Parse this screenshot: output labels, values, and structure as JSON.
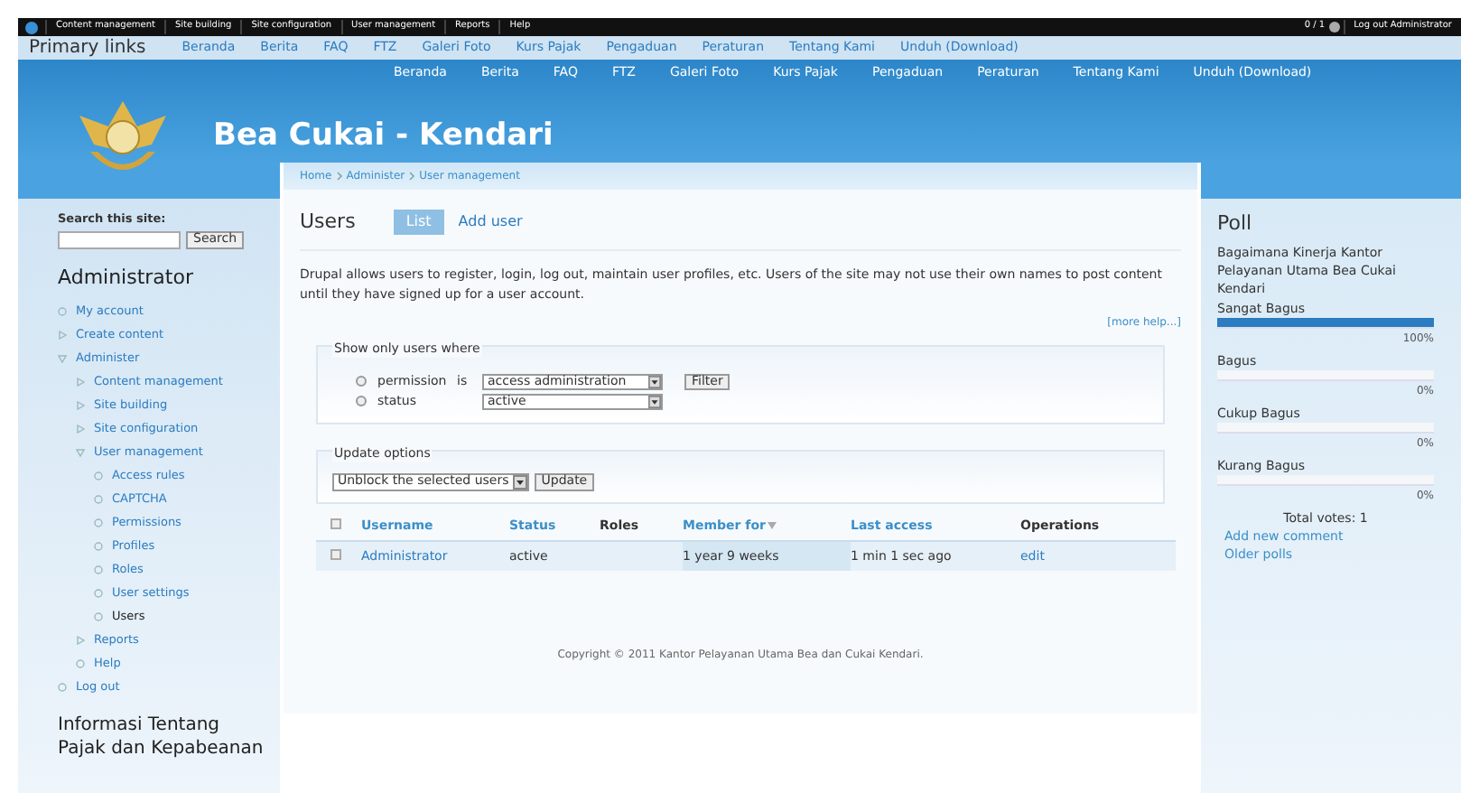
{
  "admin_bar": {
    "items": [
      "Content management",
      "Site building",
      "Site configuration",
      "User management",
      "Reports",
      "Help"
    ],
    "counter": "0 / 1",
    "logout": "Log out Administrator"
  },
  "primary_links": {
    "title": "Primary links",
    "items": [
      "Beranda",
      "Berita",
      "FAQ",
      "FTZ",
      "Galeri Foto",
      "Kurs Pajak",
      "Pengaduan",
      "Peraturan",
      "Tentang Kami",
      "Unduh (Download)"
    ]
  },
  "header": {
    "nav": [
      "Beranda",
      "Berita",
      "FAQ",
      "FTZ",
      "Galeri Foto",
      "Kurs Pajak",
      "Pengaduan",
      "Peraturan",
      "Tentang Kami",
      "Unduh (Download)"
    ],
    "site_name": "Bea Cukai - Kendari"
  },
  "sidebar": {
    "search_label": "Search this site:",
    "search_button": "Search",
    "menu_title": "Administrator",
    "menu": [
      {
        "label": "My account",
        "kind": "leaf",
        "selected": false
      },
      {
        "label": "Create content",
        "kind": "collapsed",
        "selected": false
      },
      {
        "label": "Administer",
        "kind": "expanded",
        "selected": false,
        "children": [
          {
            "label": "Content management",
            "kind": "collapsed",
            "selected": false
          },
          {
            "label": "Site building",
            "kind": "collapsed",
            "selected": false
          },
          {
            "label": "Site configuration",
            "kind": "collapsed",
            "selected": false
          },
          {
            "label": "User management",
            "kind": "expanded",
            "selected": false,
            "children": [
              {
                "label": "Access rules",
                "kind": "leaf",
                "selected": false
              },
              {
                "label": "CAPTCHA",
                "kind": "leaf",
                "selected": false
              },
              {
                "label": "Permissions",
                "kind": "leaf",
                "selected": false
              },
              {
                "label": "Profiles",
                "kind": "leaf",
                "selected": false
              },
              {
                "label": "Roles",
                "kind": "leaf",
                "selected": false
              },
              {
                "label": "User settings",
                "kind": "leaf",
                "selected": false
              },
              {
                "label": "Users",
                "kind": "leaf",
                "selected": true
              }
            ]
          },
          {
            "label": "Reports",
            "kind": "collapsed",
            "selected": false
          },
          {
            "label": "Help",
            "kind": "leaf",
            "selected": false
          }
        ]
      },
      {
        "label": "Log out",
        "kind": "leaf",
        "selected": false
      }
    ],
    "block_title": "Informasi Tentang Pajak dan Kepabeanan"
  },
  "breadcrumb": [
    "Home",
    "Administer",
    "User management"
  ],
  "page": {
    "title": "Users",
    "tabs": [
      {
        "label": "List",
        "selected": true
      },
      {
        "label": "Add user",
        "selected": false
      }
    ],
    "help": "Drupal allows users to register, login, log out, maintain user profiles, etc. Users of the site may not use their own names to post content until they have signed up for a user account.",
    "more_help": "[more help...]"
  },
  "filter": {
    "legend": "Show only users where",
    "rows": [
      {
        "label": "permission",
        "selected": false,
        "operator": "is",
        "value": "access administration"
      },
      {
        "label": "status",
        "selected": false,
        "value": "active"
      }
    ],
    "button": "Filter"
  },
  "update": {
    "legend": "Update options",
    "value": "Unblock the selected users",
    "button": "Update"
  },
  "table": {
    "select_all_checked": false,
    "columns": [
      {
        "label": "Username",
        "kind": "link"
      },
      {
        "label": "Status",
        "kind": "link"
      },
      {
        "label": "Roles",
        "kind": "plain"
      },
      {
        "label": "Member for",
        "kind": "sorted"
      },
      {
        "label": "Last access",
        "kind": "link"
      },
      {
        "label": "Operations",
        "kind": "plain"
      }
    ],
    "rows": [
      {
        "checked": false,
        "cells": [
          "Administrator",
          "active",
          "",
          "1 year 9 weeks",
          "1 min 1 sec ago",
          "edit"
        ]
      }
    ]
  },
  "footer": "Copyright © 2011 Kantor Pelayanan Utama Bea dan Cukai Kendari.",
  "poll": {
    "title": "Poll",
    "question": "Bagaimana Kinerja Kantor Pelayanan Utama Bea Cukai Kendari",
    "choices": [
      {
        "label": "Sangat Bagus",
        "level": 1,
        "percent": "100%"
      },
      {
        "label": "Bagus",
        "level": 0,
        "percent": "0%"
      },
      {
        "label": "Cukup Bagus",
        "level": 0,
        "percent": "0%"
      },
      {
        "label": "Kurang Bagus",
        "level": 0,
        "percent": "0%"
      }
    ],
    "total": "Total votes: 1",
    "links": [
      "Add new comment",
      "Older polls"
    ]
  }
}
